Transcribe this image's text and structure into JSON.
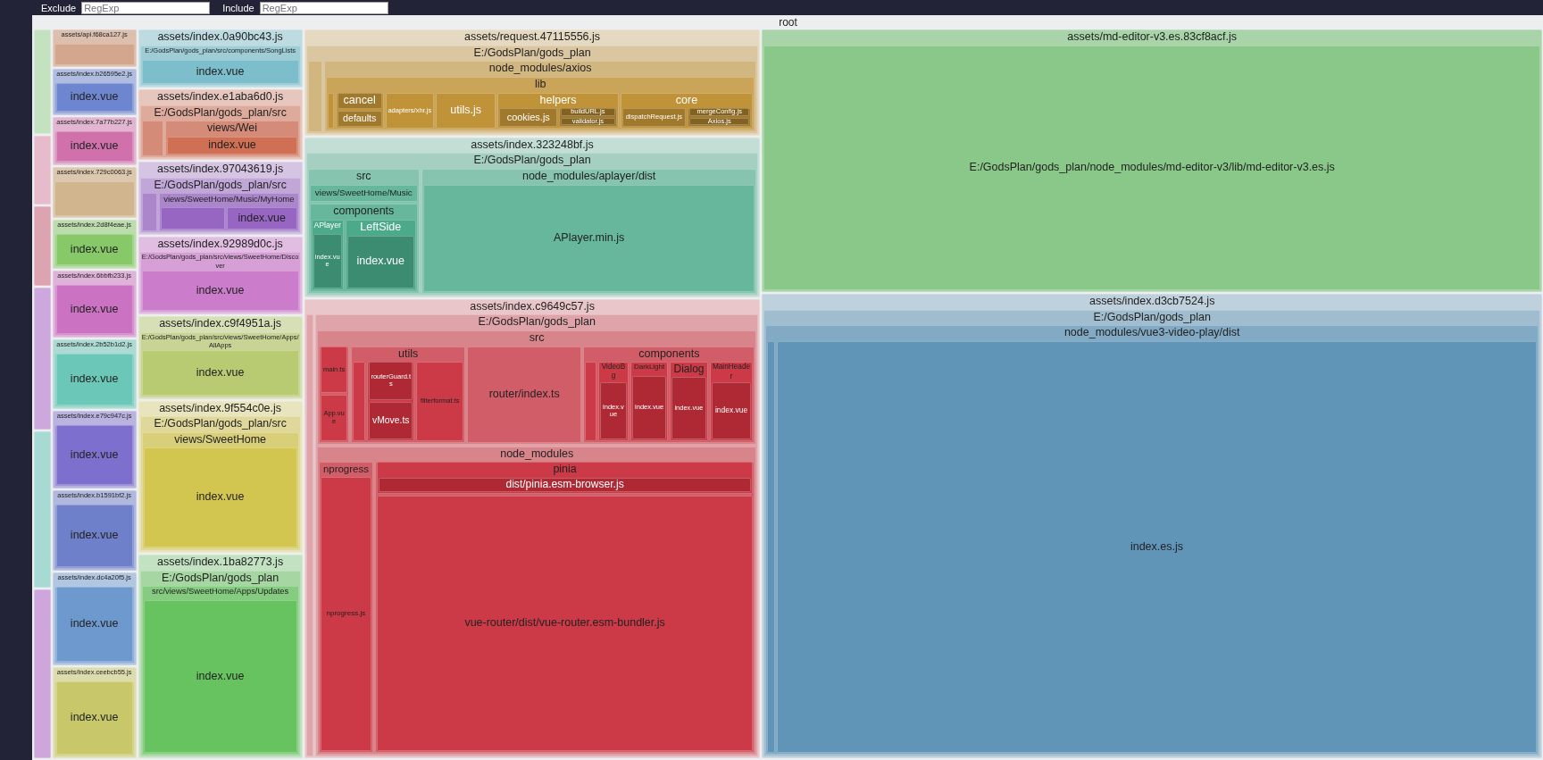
{
  "filters": [
    {
      "label": "Exclude",
      "placeholder": "RegExp"
    },
    {
      "label": "Include",
      "placeholder": "RegExp"
    }
  ],
  "root": {
    "label": "root"
  },
  "chunks": [
    {
      "color": "#c4e2c0"
    },
    {
      "color": "#e6bccc"
    },
    {
      "color": "#dca3b1"
    },
    {
      "color": "#cda8dc"
    },
    {
      "color": "#a6dad2"
    },
    {
      "color": "#cfa6dc"
    },
    {
      "label": "assets/api.f68ca127.js",
      "color": "#dcbfae"
    },
    {
      "label": "assets/index.b26595e2.js",
      "color": "#b1bde0",
      "children": [
        {
          "children": [
            {
              "label": "index.vue"
            }
          ]
        }
      ]
    },
    {
      "label": "assets/index.7a77b227.js",
      "color": "#e2b6d1",
      "children": [
        {
          "children": [
            {
              "label": "index.vue"
            }
          ]
        }
      ]
    },
    {
      "label": "assets/index.729c0063.js",
      "color": "#dbc8ae"
    },
    {
      "label": "assets/index.2d8f4eae.js",
      "color": "#bcdcad",
      "children": [
        {
          "children": [
            {
              "label": "index.vue"
            }
          ]
        }
      ]
    },
    {
      "label": "assets/index.6bbfb233.js",
      "color": "#deb3da",
      "children": [
        {
          "children": [
            {
              "label": "index.vue"
            }
          ]
        }
      ]
    },
    {
      "label": "assets/index.2b52b1d2.js",
      "color": "#addbd3",
      "children": [
        {
          "children": [
            {
              "label": "index.vue"
            }
          ]
        }
      ]
    },
    {
      "label": "assets/index.e79c947c.js",
      "color": "#bab3e0",
      "children": [
        {
          "children": [
            {
              "label": "index.vue"
            }
          ]
        }
      ]
    },
    {
      "label": "assets/index.b1591bf2.js",
      "color": "#b0b9dd",
      "children": [
        {
          "children": [
            {
              "label": "index.vue"
            }
          ]
        }
      ]
    },
    {
      "label": "assets/index.dc4a20f5.js",
      "color": "#b1c6e0",
      "children": [
        {
          "children": [
            {
              "label": "index.vue"
            }
          ]
        }
      ]
    },
    {
      "label": "assets/index.ceebcb55.js",
      "color": "#dcdcae",
      "children": [
        {
          "children": [
            {
              "label": "index.vue"
            }
          ]
        }
      ]
    },
    {
      "label": "assets/index.0a90bc43.js",
      "color": "#bddbe1",
      "children": [
        {
          "label": "E:/GodsPlan/gods_plan/src/components/SongLists",
          "children": [
            {
              "label": "index.vue"
            }
          ]
        }
      ]
    },
    {
      "label": "assets/index.e1aba6d0.js",
      "color": "#e6c6bd",
      "children": [
        {
          "label": "E:/GodsPlan/gods_plan/src",
          "children": [
            {
              "label": "views/Wei",
              "children": [
                {
                  "label": "index.vue"
                }
              ]
            }
          ]
        }
      ]
    },
    {
      "label": "assets/index.97043619.js",
      "color": "#d5c5e3",
      "children": [
        {
          "label": "E:/GodsPlan/gods_plan/src",
          "children": [
            {
              "label": "views/SweetHome/Music/MyHome",
              "children": [
                {
                  "label": "index.vue"
                }
              ]
            }
          ]
        }
      ]
    },
    {
      "label": "assets/index.92989d0c.js",
      "color": "#e1bde1",
      "children": [
        {
          "label": "E:/GodsPlan/gods_plan/src/views/SweetHome/Discover",
          "children": [
            {
              "label": "index.vue"
            }
          ]
        }
      ]
    },
    {
      "label": "assets/index.c9f4951a.js",
      "color": "#d7dfb6",
      "children": [
        {
          "label": "E:/GodsPlan/gods_plan/src/views/SweetHome/Apps/AllApps",
          "children": [
            {
              "label": "index.vue"
            }
          ]
        }
      ]
    },
    {
      "label": "assets/index.9f554c0e.js",
      "color": "#e8e4bd",
      "children": [
        {
          "label": "E:/GodsPlan/gods_plan/src",
          "children": [
            {
              "label": "views/SweetHome",
              "children": [
                {
                  "label": "index.vue"
                }
              ]
            }
          ]
        }
      ]
    },
    {
      "label": "assets/index.1ba82773.js",
      "color": "#c3e2c1",
      "children": [
        {
          "label": "E:/GodsPlan/gods_plan",
          "children": [
            {
              "label": "src/views/SweetHome/Apps/Updates",
              "children": [
                {
                  "label": "index.vue"
                }
              ]
            }
          ]
        }
      ]
    },
    {
      "label": "assets/request.47115556.js",
      "color": "#e5d9c1",
      "children": [
        {
          "label": "E:/GodsPlan/gods_plan",
          "children": [
            {
              "label": "node_modules/axios",
              "children": [
                {
                  "label": "lib",
                  "children": [
                    {
                      "children": [
                        {
                          "label": "cancel"
                        },
                        {
                          "label": "defaults"
                        }
                      ]
                    },
                    {
                      "label": "adapters/xhr.js"
                    },
                    {
                      "label": "utils.js"
                    },
                    {
                      "label": "helpers",
                      "children": [
                        {
                          "label": "cookies.js"
                        },
                        {
                          "children": [
                            {
                              "label": "buildURL.js"
                            },
                            {
                              "label": "validator.js"
                            }
                          ]
                        }
                      ]
                    },
                    {
                      "label": "core",
                      "children": [
                        {
                          "label": "dispatchRequest.js"
                        },
                        {
                          "children": [
                            {
                              "label": "mergeConfig.js"
                            },
                            {
                              "label": "Axios.js"
                            }
                          ]
                        }
                      ]
                    }
                  ]
                }
              ]
            }
          ]
        }
      ]
    },
    {
      "label": "assets/index.323248bf.js",
      "color": "#c3ded5",
      "children": [
        {
          "label": "E:/GodsPlan/gods_plan",
          "children": [
            {
              "label": "src",
              "children": [
                {
                  "label": "views/SweetHome/Music"
                },
                {
                  "label": "components",
                  "children": [
                    {
                      "label": "APlayer",
                      "children": [
                        {
                          "label": "index.vue"
                        }
                      ]
                    },
                    {
                      "label": "LeftSide",
                      "children": [
                        {
                          "label": "index.vue"
                        }
                      ]
                    }
                  ]
                }
              ]
            },
            {
              "label": "node_modules/aplayer/dist",
              "children": [
                {
                  "label": "APlayer.min.js"
                }
              ]
            }
          ]
        }
      ]
    },
    {
      "label": "assets/index.c9649c57.js",
      "color": "#e9c6c9",
      "children": [
        {
          "label": "E:/GodsPlan/gods_plan",
          "children": [
            {
              "label": "src",
              "children": [
                {
                  "children": [
                    {
                      "label": "main.ts"
                    },
                    {
                      "label": "App.vue"
                    }
                  ]
                },
                {
                  "label": "utils",
                  "children": [
                    {
                      "children": [
                        {
                          "label": "routerGuard.ts"
                        },
                        {
                          "label": "vMove.ts"
                        }
                      ]
                    },
                    {
                      "label": "filterformat.ts"
                    }
                  ]
                },
                {
                  "label": "router/index.ts"
                },
                {
                  "label": "components",
                  "children": [
                    {
                      "label": "VideoBg",
                      "children": [
                        {
                          "label": "index.vue"
                        }
                      ]
                    },
                    {
                      "label": "DarkLight",
                      "children": [
                        {
                          "label": "index.vue"
                        }
                      ]
                    },
                    {
                      "label": "Dialog",
                      "children": [
                        {
                          "label": "index.vue"
                        }
                      ]
                    },
                    {
                      "label": "MainHeader",
                      "children": [
                        {
                          "label": "index.vue"
                        }
                      ]
                    }
                  ]
                }
              ]
            },
            {
              "label": "node_modules",
              "children": [
                {
                  "label": "nprogress",
                  "children": [
                    {
                      "label": "nprogress.js"
                    }
                  ]
                },
                {
                  "children": [
                    {
                      "label": "pinia",
                      "children": [
                        {
                          "label": "dist/pinia.esm-browser.js"
                        }
                      ]
                    },
                    {
                      "label": "vue-router/dist/vue-router.esm-bundler.js"
                    }
                  ]
                }
              ]
            }
          ]
        }
      ]
    },
    {
      "label": "assets/md-editor-v3.es.83cf8acf.js",
      "color": "#a9d4a9",
      "children": [
        {
          "label": "E:/GodsPlan/gods_plan/node_modules/md-editor-v3/lib/md-editor-v3.es.js"
        }
      ]
    },
    {
      "label": "assets/index.d3cb7524.js",
      "color": "#bfd1dd",
      "children": [
        {
          "label": "E:/GodsPlan/gods_plan",
          "children": [
            {
              "label": "node_modules/vue3-video-play/dist",
              "children": [
                {
                  "label": "index.es.js"
                }
              ]
            }
          ]
        }
      ]
    }
  ]
}
